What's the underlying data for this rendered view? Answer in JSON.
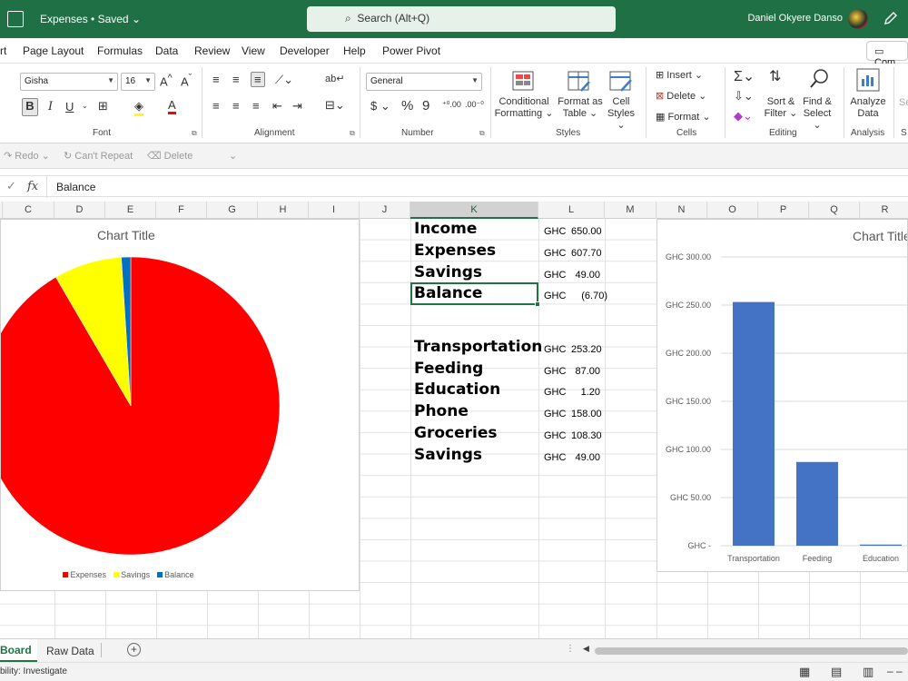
{
  "titlebar": {
    "doc_title": "Expenses • Saved",
    "search_placeholder": "Search (Alt+Q)",
    "user": "Daniel Okyere Danso"
  },
  "menu": {
    "items": [
      "rt",
      "Page Layout",
      "Formulas",
      "Data",
      "Review",
      "View",
      "Developer",
      "Help",
      "Power Pivot"
    ],
    "comments": "Com"
  },
  "ribbon": {
    "font_name": "Gisha",
    "font_size": "16",
    "number_format": "General",
    "groups": {
      "font": "Font",
      "alignment": "Alignment",
      "number": "Number",
      "styles": "Styles",
      "cells": "Cells",
      "editing": "Editing",
      "analysis": "Analysis"
    },
    "conditional_formatting": [
      "Conditional",
      "Formatting"
    ],
    "format_as_table": [
      "Format as",
      "Table"
    ],
    "cell_styles": [
      "Cell",
      "Styles"
    ],
    "insert": "Insert",
    "delete": "Delete",
    "format": "Format",
    "sort_filter": [
      "Sort &",
      "Filter"
    ],
    "find_select": [
      "Find &",
      "Select"
    ],
    "analyze_data": [
      "Analyze",
      "Data"
    ],
    "sen": "Se"
  },
  "qat": {
    "redo": "Redo",
    "cant_repeat": "Can't Repeat",
    "delete": "Delete"
  },
  "formula_bar": {
    "value": "Balance"
  },
  "columns": [
    "C",
    "D",
    "E",
    "F",
    "G",
    "H",
    "I",
    "J",
    "K",
    "L",
    "M",
    "N",
    "O",
    "P",
    "Q",
    "R"
  ],
  "summary": [
    {
      "label": "Income",
      "currency": "GHC",
      "amount": "650.00"
    },
    {
      "label": "Expenses",
      "currency": "GHC",
      "amount": "607.70"
    },
    {
      "label": "Savings",
      "currency": "GHC",
      "amount": "49.00"
    },
    {
      "label": "Balance",
      "currency": "GHC",
      "amount": "(6.70)"
    }
  ],
  "categories": [
    {
      "label": "Transportation",
      "currency": "GHC",
      "amount": "253.20"
    },
    {
      "label": "Feeding",
      "currency": "GHC",
      "amount": "87.00"
    },
    {
      "label": "Education",
      "currency": "GHC",
      "amount": "1.20"
    },
    {
      "label": "Phone",
      "currency": "GHC",
      "amount": "158.00"
    },
    {
      "label": "Groceries",
      "currency": "GHC",
      "amount": "108.30"
    },
    {
      "label": "Savings",
      "currency": "GHC",
      "amount": "49.00"
    }
  ],
  "chart_data": [
    {
      "type": "pie",
      "title": "Chart Title",
      "categories": [
        "Expenses",
        "Savings",
        "Balance"
      ],
      "values": [
        607.7,
        49.0,
        6.7
      ],
      "colors": [
        "#ff0000",
        "#ffff00",
        "#0070c0"
      ],
      "legend": "bottom"
    },
    {
      "type": "bar",
      "title": "Chart Title",
      "categories": [
        "Transportation",
        "Feeding",
        "Education"
      ],
      "values": [
        253.2,
        87.0,
        1.2
      ],
      "color": "#4472c4",
      "ylim": [
        0,
        300
      ],
      "yticks": [
        "GHC 300.00",
        "GHC 250.00",
        "GHC 200.00",
        "GHC 150.00",
        "GHC 100.00",
        "GHC 50.00",
        "GHC -"
      ],
      "grid": true
    }
  ],
  "sheet_tabs": {
    "active": "Board",
    "other": "Raw Data"
  },
  "status": {
    "accessibility": "bility: Investigate"
  }
}
